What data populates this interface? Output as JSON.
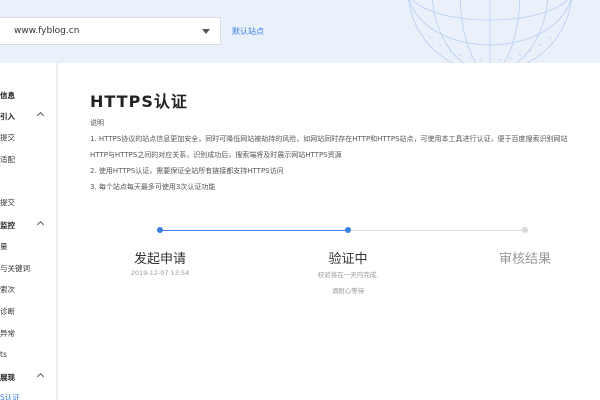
{
  "header": {
    "site_value": "www.fyblog.cn",
    "default_site_label": "默认站点"
  },
  "sidebar": {
    "items": [
      {
        "label": "信息",
        "type": "group"
      },
      {
        "label": "引入",
        "type": "group"
      },
      {
        "label": "提交",
        "type": "item"
      },
      {
        "label": "适配",
        "type": "item"
      },
      {
        "label": "提交",
        "type": "item"
      },
      {
        "label": "监控",
        "type": "group"
      },
      {
        "label": "量",
        "type": "item"
      },
      {
        "label": "与关键词",
        "type": "item"
      },
      {
        "label": "索次",
        "type": "item"
      },
      {
        "label": "诊断",
        "type": "item"
      },
      {
        "label": "异常",
        "type": "item"
      },
      {
        "label": "ts",
        "type": "item"
      },
      {
        "label": "展现",
        "type": "group"
      },
      {
        "label": "S认证",
        "type": "item",
        "active": true
      }
    ]
  },
  "main": {
    "title": "HTTPS认证",
    "desc_head": "说明",
    "desc_lines": [
      "1. HTTPS协议的站点信息更加安全，同时可降低网站被劫持的风险，如网站同时存在HTTP和HTTPS站点，可使用本工具进行认证，便于百度搜索识别网站",
      "HTTP与HTTPS之间的对应关系，识别成功后，搜索端将及时展示网站HTTPS资源",
      "2. 使用HTTPS认证，需要保证全站所有链接都支持HTTPS访问",
      "3. 每个站点每天最多可使用3次认证功能"
    ],
    "steps": [
      {
        "title": "发起申请",
        "sub": "2019-12-07 13:54",
        "sub2": ""
      },
      {
        "title": "验证中",
        "sub": "校验将在一天内完成,",
        "sub2": "请耐心等待"
      },
      {
        "title": "审核结果",
        "sub": "",
        "sub2": ""
      }
    ]
  },
  "colors": {
    "accent": "#3b7ee6",
    "inactive": "#d9d9d9",
    "done_text": "#333333",
    "pending_text": "#999999"
  }
}
